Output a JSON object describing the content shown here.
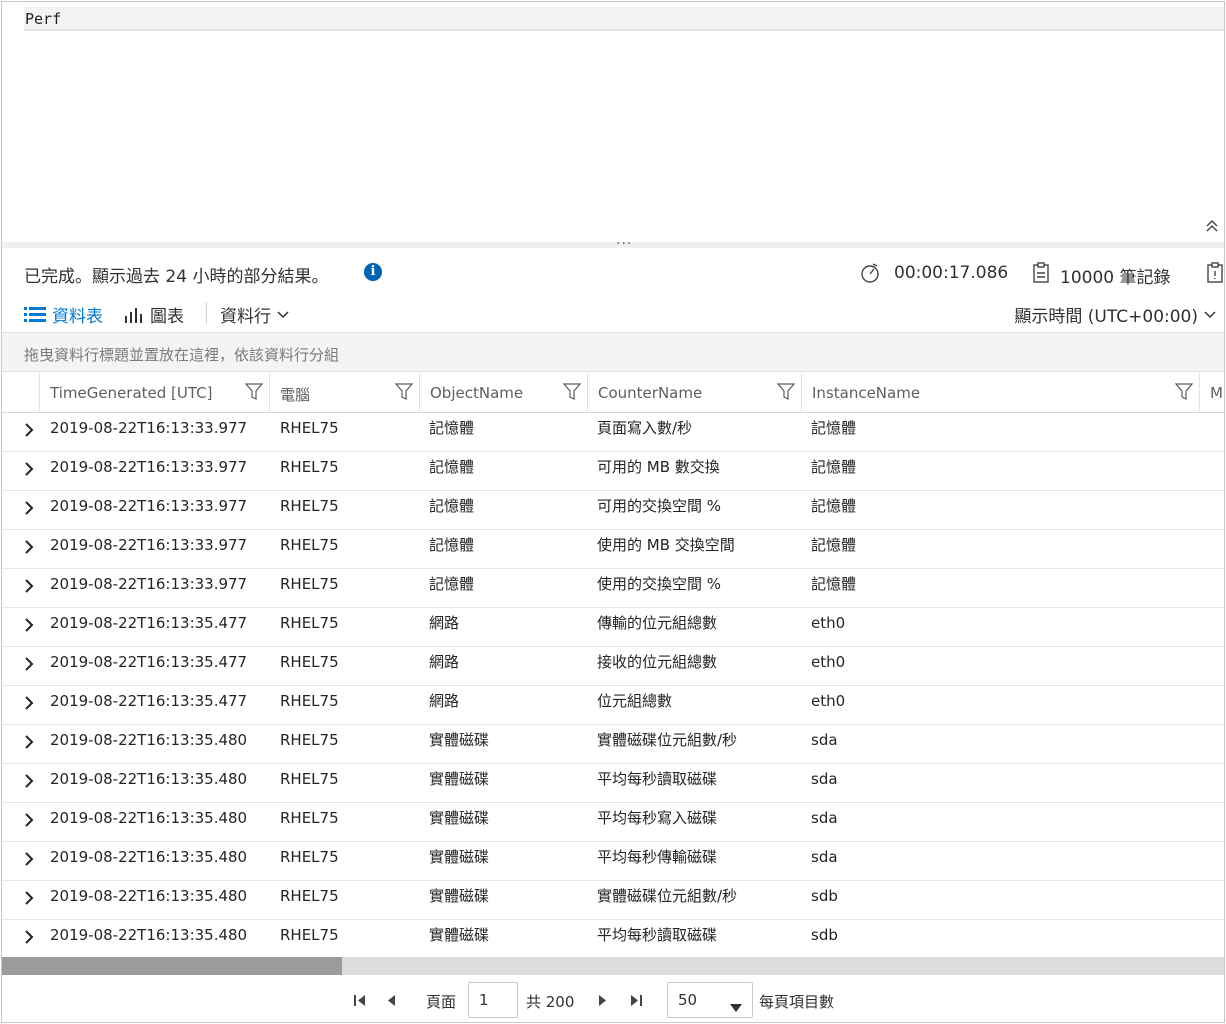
{
  "editor": {
    "query": "Perf"
  },
  "status": {
    "message": "已完成。顯示過去 24 小時的部分結果。",
    "elapsed": "00:00:17.086",
    "records": "10000 筆記錄"
  },
  "toolbar": {
    "table_label": "資料表",
    "chart_label": "圖表",
    "columns_label": "資料行",
    "time_label": "顯示時間 (UTC+00:00)"
  },
  "groupbar": {
    "hint": "拖曳資料行標題並置放在這裡，依該資料行分組"
  },
  "grid": {
    "columns": [
      "TimeGenerated [UTC]",
      "電腦",
      "ObjectName",
      "CounterName",
      "InstanceName",
      "M"
    ],
    "rows": [
      [
        "2019-08-22T16:13:33.977",
        "RHEL75",
        "記憶體",
        "頁面寫入數/秒",
        "記憶體"
      ],
      [
        "2019-08-22T16:13:33.977",
        "RHEL75",
        "記憶體",
        "可用的 MB 數交換",
        "記憶體"
      ],
      [
        "2019-08-22T16:13:33.977",
        "RHEL75",
        "記憶體",
        "可用的交換空間 %",
        "記憶體"
      ],
      [
        "2019-08-22T16:13:33.977",
        "RHEL75",
        "記憶體",
        "使用的 MB 交換空間",
        "記憶體"
      ],
      [
        "2019-08-22T16:13:33.977",
        "RHEL75",
        "記憶體",
        "使用的交換空間 %",
        "記憶體"
      ],
      [
        "2019-08-22T16:13:35.477",
        "RHEL75",
        "網路",
        "傳輸的位元組總數",
        "eth0"
      ],
      [
        "2019-08-22T16:13:35.477",
        "RHEL75",
        "網路",
        "接收的位元組總數",
        "eth0"
      ],
      [
        "2019-08-22T16:13:35.477",
        "RHEL75",
        "網路",
        "位元組總數",
        "eth0"
      ],
      [
        "2019-08-22T16:13:35.480",
        "RHEL75",
        "實體磁碟",
        "實體磁碟位元組數/秒",
        "sda"
      ],
      [
        "2019-08-22T16:13:35.480",
        "RHEL75",
        "實體磁碟",
        "平均每秒讀取磁碟",
        "sda"
      ],
      [
        "2019-08-22T16:13:35.480",
        "RHEL75",
        "實體磁碟",
        "平均每秒寫入磁碟",
        "sda"
      ],
      [
        "2019-08-22T16:13:35.480",
        "RHEL75",
        "實體磁碟",
        "平均每秒傳輸磁碟",
        "sda"
      ],
      [
        "2019-08-22T16:13:35.480",
        "RHEL75",
        "實體磁碟",
        "實體磁碟位元組數/秒",
        "sdb"
      ],
      [
        "2019-08-22T16:13:35.480",
        "RHEL75",
        "實體磁碟",
        "平均每秒讀取磁碟",
        "sdb"
      ]
    ]
  },
  "pager": {
    "page_label": "頁面",
    "page_value": "1",
    "total_label": "共 200",
    "page_size": "50",
    "page_size_label": "每頁項目數"
  },
  "colors": {
    "accent": "#0078d4",
    "info": "#0063b1"
  }
}
